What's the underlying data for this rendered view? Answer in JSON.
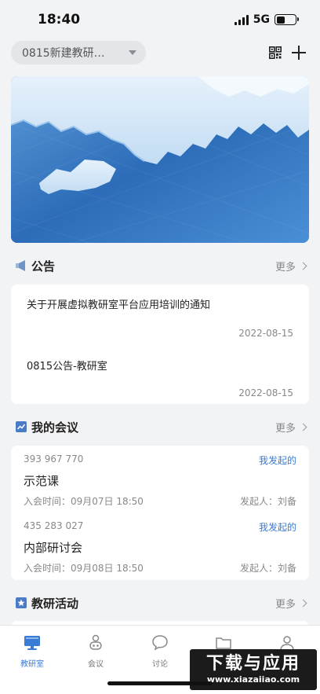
{
  "status": {
    "time": "18:40",
    "network": "5G"
  },
  "header": {
    "selector_label": "0815新建教研…"
  },
  "announcements": {
    "title": "公告",
    "more": "更多",
    "items": [
      {
        "text": "关于开展虚拟教研室平台应用培训的通知",
        "date": "2022-08-15"
      },
      {
        "text": "0815公告-教研室",
        "date": "2022-08-15"
      }
    ]
  },
  "meetings": {
    "title": "我的会议",
    "more": "更多",
    "items": [
      {
        "id": "393 967 770",
        "tag": "我发起的",
        "title": "示范课",
        "time": "入会时间：09月07日 18:50",
        "host": "发起人：刘备"
      },
      {
        "id": "435 283 027",
        "tag": "我发起的",
        "title": "内部研讨会",
        "time": "入会时间：09月08日 18:50",
        "host": "发起人：刘备"
      }
    ]
  },
  "activities": {
    "title": "教研活动",
    "more": "更多"
  },
  "tabs": [
    {
      "label": "教研室",
      "icon": "monitor-icon",
      "active": true
    },
    {
      "label": "会议",
      "icon": "meeting-icon"
    },
    {
      "label": "讨论",
      "icon": "chat-icon"
    },
    {
      "label": "",
      "icon": "folder-icon"
    },
    {
      "label": "",
      "icon": "user-icon"
    }
  ],
  "watermark": {
    "title": "下载与应用",
    "url": "www.xiazaiiao.com"
  },
  "colors": {
    "accent": "#3a7bd5",
    "background": "#f2f3f5"
  }
}
